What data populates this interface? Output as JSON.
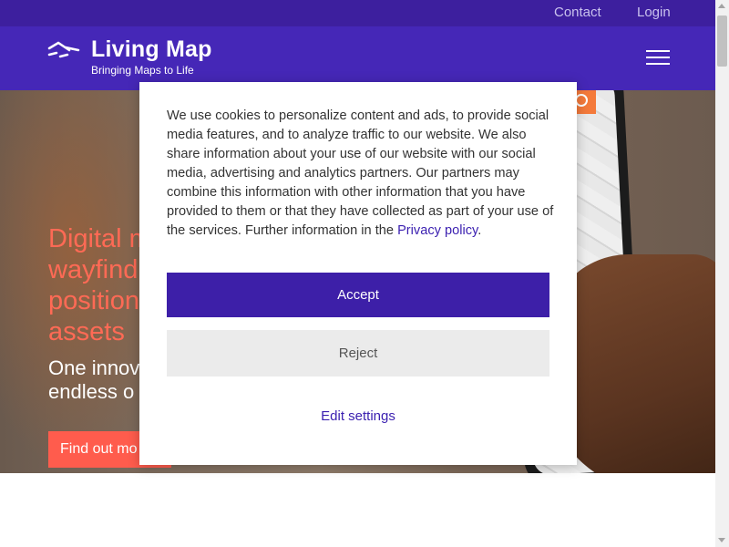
{
  "topbar": {
    "contact": "Contact",
    "login": "Login"
  },
  "header": {
    "logo_title": "Living Map",
    "logo_tagline": "Bringing Maps to Life",
    "menu_icon": "hamburger-icon"
  },
  "hero": {
    "heading_lines": [
      "Digital m",
      "wayfind",
      "position",
      "assets"
    ],
    "sub_lines": [
      "One innov",
      "endless o"
    ],
    "cta": "Find out mo"
  },
  "cookie": {
    "text": "We use cookies to personalize content and ads, to provide social media features, and to analyze traffic to our website. We also share information about your use of our website with our social media, advertising and analytics partners. Our partners may combine this information with other information that you have provided to them or that they have collected as part of your use of the services. Further information in the ",
    "link": "Privacy policy",
    "after_link": ".",
    "accept": "Accept",
    "reject": "Reject",
    "edit": "Edit settings"
  },
  "colors": {
    "topbar": "#3d1f9e",
    "header": "#4527b7",
    "accent": "#ff5c4d",
    "heading": "#ff6a55",
    "accept": "#3d1fa8",
    "link": "#3a1fb0"
  }
}
